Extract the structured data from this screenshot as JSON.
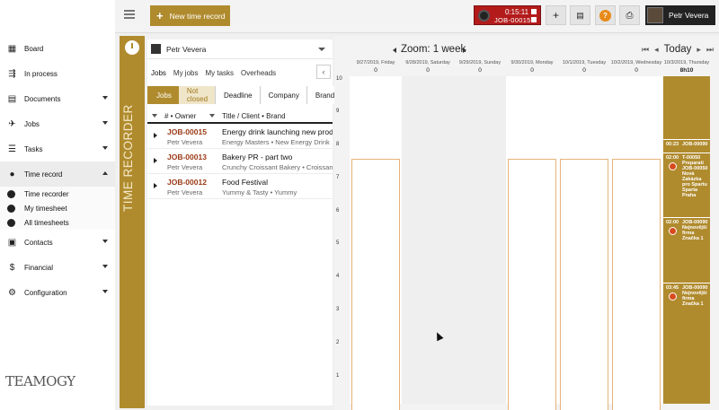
{
  "topbar": {
    "new_record_label": "New time record",
    "timer": {
      "time": "0:15:11",
      "job": "JOB-00015"
    },
    "help_label": "?",
    "user_name": "Petr Vevera"
  },
  "sidebar": {
    "items": [
      {
        "label": "Board",
        "icon": "grid-icon"
      },
      {
        "label": "In process",
        "icon": "process-icon"
      },
      {
        "label": "Documents",
        "icon": "document-icon"
      },
      {
        "label": "Jobs",
        "icon": "rocket-icon"
      },
      {
        "label": "Tasks",
        "icon": "tasks-icon"
      },
      {
        "label": "Time record",
        "icon": "clock-icon"
      },
      {
        "label": "Contacts",
        "icon": "contacts-icon"
      },
      {
        "label": "Financial",
        "icon": "dollar-icon"
      },
      {
        "label": "Configuration",
        "icon": "gear-icon"
      }
    ],
    "sub_items": [
      "Time recorder",
      "My timesheet",
      "All timesheets"
    ],
    "logo": "TEAMOGY"
  },
  "strip_label": "TIME RECORDER",
  "panel": {
    "owner": "Petr Vevera",
    "tabs": [
      "Jobs",
      "My jobs",
      "My tasks",
      "Overheads"
    ],
    "filters": [
      "Jobs",
      "Not closed",
      "Deadline",
      "Company",
      "Brand"
    ],
    "columns": [
      "# • Owner",
      "Title / Client • Brand"
    ],
    "rows": [
      {
        "code": "JOB-00015",
        "owner": "Petr Vevera",
        "title": "Energy drink launching new product",
        "client": "Energy Masters • New Energy Drink"
      },
      {
        "code": "JOB-00013",
        "owner": "Petr Vevera",
        "title": "Bakery PR - part two",
        "client": "Crunchy Croissant Bakery • Croissant"
      },
      {
        "code": "JOB-00012",
        "owner": "Petr Vevera",
        "title": "Food Festival",
        "client": "Yummy & Tasty • Yummy"
      }
    ]
  },
  "calendar": {
    "zoom_label": "Zoom: 1 week",
    "today_label": "Today",
    "y_ticks": [
      "10",
      "9",
      "8",
      "7",
      "6",
      "5",
      "4",
      "3",
      "2",
      "1"
    ],
    "days": [
      {
        "label": "9/27/2019, Friday",
        "count": "0"
      },
      {
        "label": "9/28/2019, Saturday",
        "count": "0"
      },
      {
        "label": "9/29/2019, Sunday",
        "count": "0"
      },
      {
        "label": "9/30/2019, Monday",
        "count": "0"
      },
      {
        "label": "10/1/2019, Tuesday",
        "count": "0"
      },
      {
        "label": "10/2/2019, Wednesday",
        "count": "0"
      },
      {
        "label": "10/3/2019, Thursday",
        "count": "8h10"
      }
    ],
    "entries": [
      {
        "time": "00:23",
        "text": "JOB-00090"
      },
      {
        "time": "02:00",
        "text": "T-00050 Preparati JOB-00050 Nová Zakázka pro Spartu Sparta Praha"
      },
      {
        "time": "02:00",
        "text": "JOB-00090 Nejnovější firma Značka 1"
      },
      {
        "time": "03:45",
        "text": "JOB-00090 Nejnovější firma Značka 1"
      }
    ]
  }
}
